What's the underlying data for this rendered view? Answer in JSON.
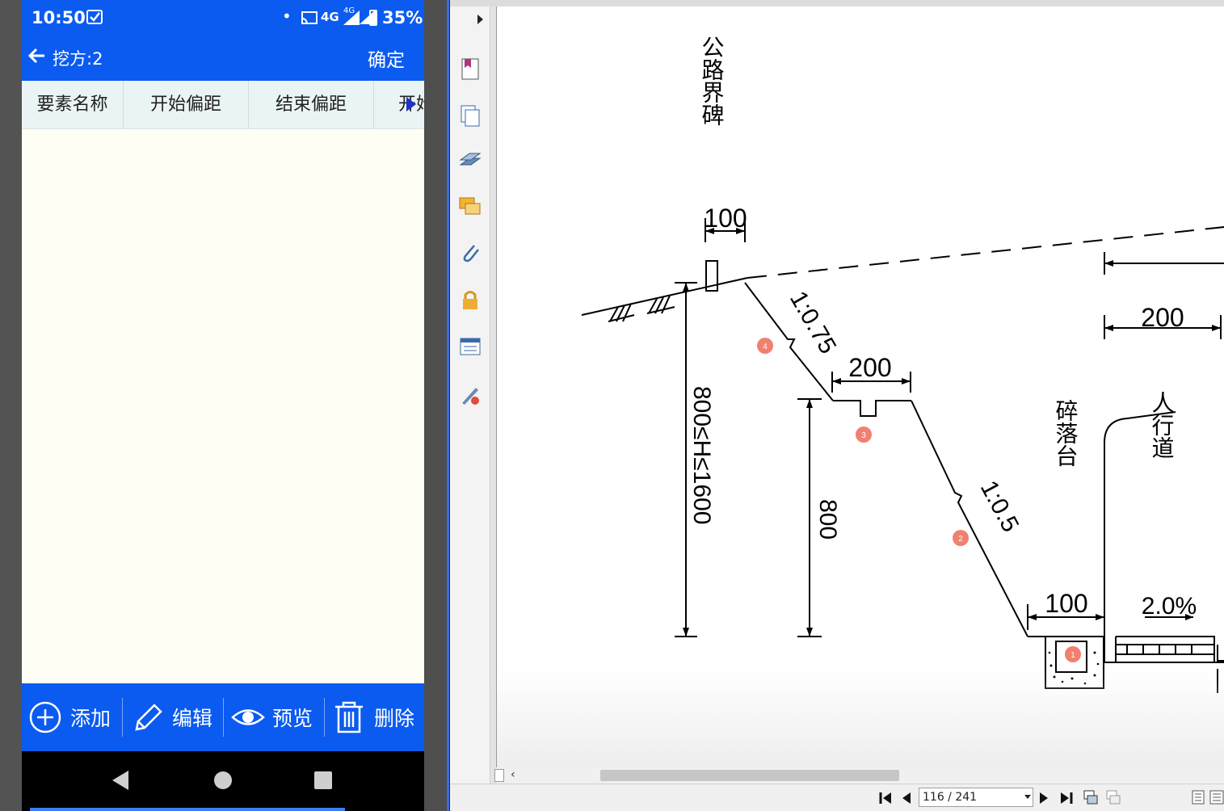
{
  "phone": {
    "status": {
      "time": "10:50",
      "network": "4G",
      "network2": "4G",
      "battery": "35%"
    },
    "app_bar": {
      "title": "挖方:2",
      "confirm": "确定"
    },
    "columns": [
      "要素名称",
      "开始偏距",
      "结束偏距",
      "开始"
    ],
    "actions": {
      "add": "添加",
      "edit": "编辑",
      "preview": "预览",
      "delete": "删除"
    }
  },
  "viewer": {
    "page_input": "116 / 241",
    "drawing": {
      "labels": {
        "boundary_marker": "公路界碑",
        "rockfall_platform": "碎落台",
        "sidewalk": "人行道",
        "dim_100_top": "100",
        "dim_200_mid": "200",
        "dim_200_right": "200",
        "dim_100_bottom": "100",
        "dim_800": "800",
        "dim_range": "800≤H≤1600",
        "slope_1": "1:0.75",
        "slope_2": "1:0.5",
        "grade": "2.0%"
      },
      "markers": [
        "4",
        "3",
        "2",
        "1"
      ]
    }
  }
}
